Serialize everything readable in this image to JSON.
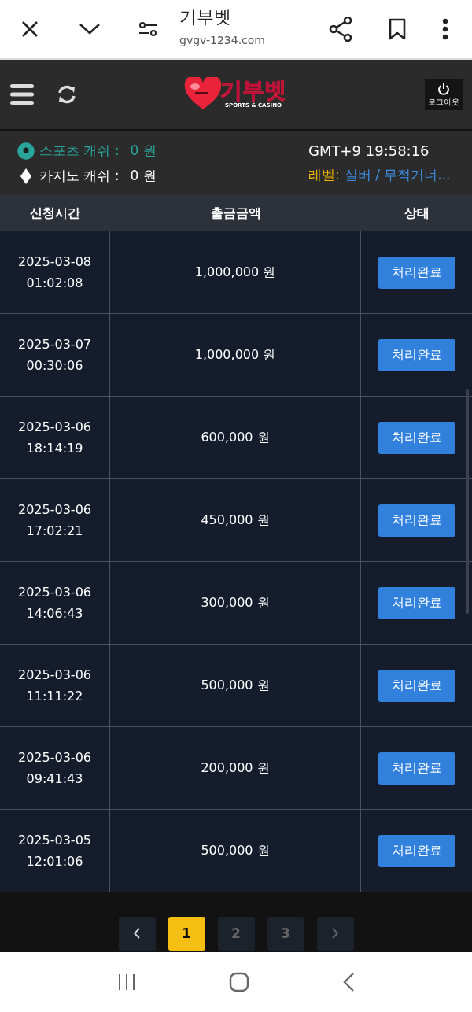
{
  "browser": {
    "title": "기부벳",
    "url": "gvgv-1234.com"
  },
  "header": {
    "logo": "기부벳",
    "logo_sub": "SPORTS & CASINO",
    "logout": "로그아웃"
  },
  "info": {
    "sports_label": "스포츠 캐쉬 :",
    "sports_value": "0 원",
    "casino_label": "카지노 캐쉬 :",
    "casino_value": "0 원",
    "clock": "GMT+9 19:58:16",
    "level_label": "레벨:",
    "level_value": "실버 / 무적거너..."
  },
  "table": {
    "columns": [
      "신청시간",
      "출금금액",
      "상태"
    ],
    "rows": [
      {
        "date": "2025-03-08",
        "time": "01:02:08",
        "amount": "1,000,000 원",
        "status": "처리완료"
      },
      {
        "date": "2025-03-07",
        "time": "00:30:06",
        "amount": "1,000,000 원",
        "status": "처리완료"
      },
      {
        "date": "2025-03-06",
        "time": "18:14:19",
        "amount": "600,000 원",
        "status": "처리완료"
      },
      {
        "date": "2025-03-06",
        "time": "17:02:21",
        "amount": "450,000 원",
        "status": "처리완료"
      },
      {
        "date": "2025-03-06",
        "time": "14:06:43",
        "amount": "300,000 원",
        "status": "처리완료"
      },
      {
        "date": "2025-03-06",
        "time": "11:11:22",
        "amount": "500,000 원",
        "status": "처리완료"
      },
      {
        "date": "2025-03-06",
        "time": "09:41:43",
        "amount": "200,000 원",
        "status": "처리완료"
      },
      {
        "date": "2025-03-05",
        "time": "12:01:06",
        "amount": "500,000 원",
        "status": "처리완료"
      }
    ]
  },
  "pagination": [
    {
      "label": "1",
      "selected": true
    },
    {
      "label": "2",
      "selected": false
    },
    {
      "label": "3",
      "selected": false
    }
  ]
}
